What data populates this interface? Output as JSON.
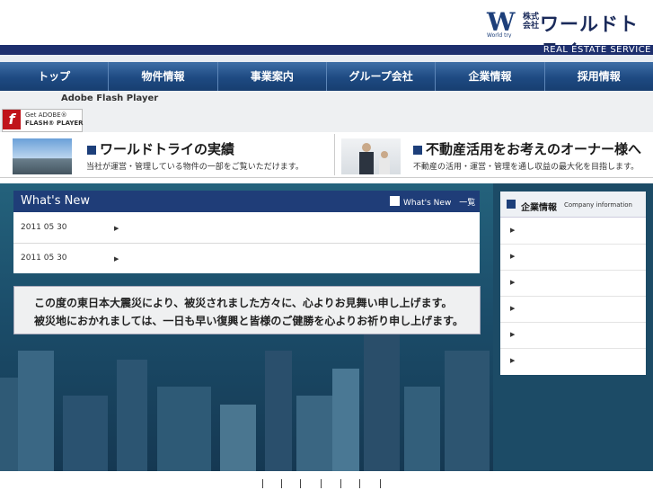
{
  "header": {
    "logo_small": "株式\n会社",
    "logo_name": "ワールドトライ",
    "service": "REAL ESTATE SERVICE"
  },
  "nav": {
    "items": [
      "トップ",
      "物件情報",
      "事業案内",
      "グループ会社",
      "企業情報",
      "採用情報"
    ]
  },
  "flash": {
    "title": "Adobe Flash Player",
    "badge_line1": "Get ADOBE®",
    "badge_line2": "FLASH® PLAYER"
  },
  "banners": [
    {
      "title": "ワールドトライの実績",
      "subtitle": "当社が運営・管理している物件の一部をご覧いただけます。"
    },
    {
      "title": "不動産活用をお考えのオーナー様へ",
      "subtitle": "不動産の活用・運営・管理を通し収益の最大化を目指します。"
    }
  ],
  "whats_new": {
    "title": "What's New",
    "link_label": "What's New　一覧",
    "items": [
      {
        "date": "2011 05 30",
        "arrow": "▶"
      },
      {
        "date": "2011 05 30",
        "arrow": "▶"
      }
    ]
  },
  "notice": {
    "line1": "この度の東日本大震災により、被災されました方々に、心よりお見舞い申し上げます。",
    "line2": "被災地におかれましては、一日も早い復興と皆様のご健勝を心よりお祈り申し上げます。"
  },
  "company": {
    "title": "企業情報",
    "subtitle": "Company information",
    "arrows": [
      "▶",
      "▶",
      "▶",
      "▶",
      "▶",
      "▶"
    ]
  },
  "colors": {
    "nav": "#1e4a82",
    "header_band": "#1d2f6e",
    "main_bg": "#1b4d6a"
  }
}
